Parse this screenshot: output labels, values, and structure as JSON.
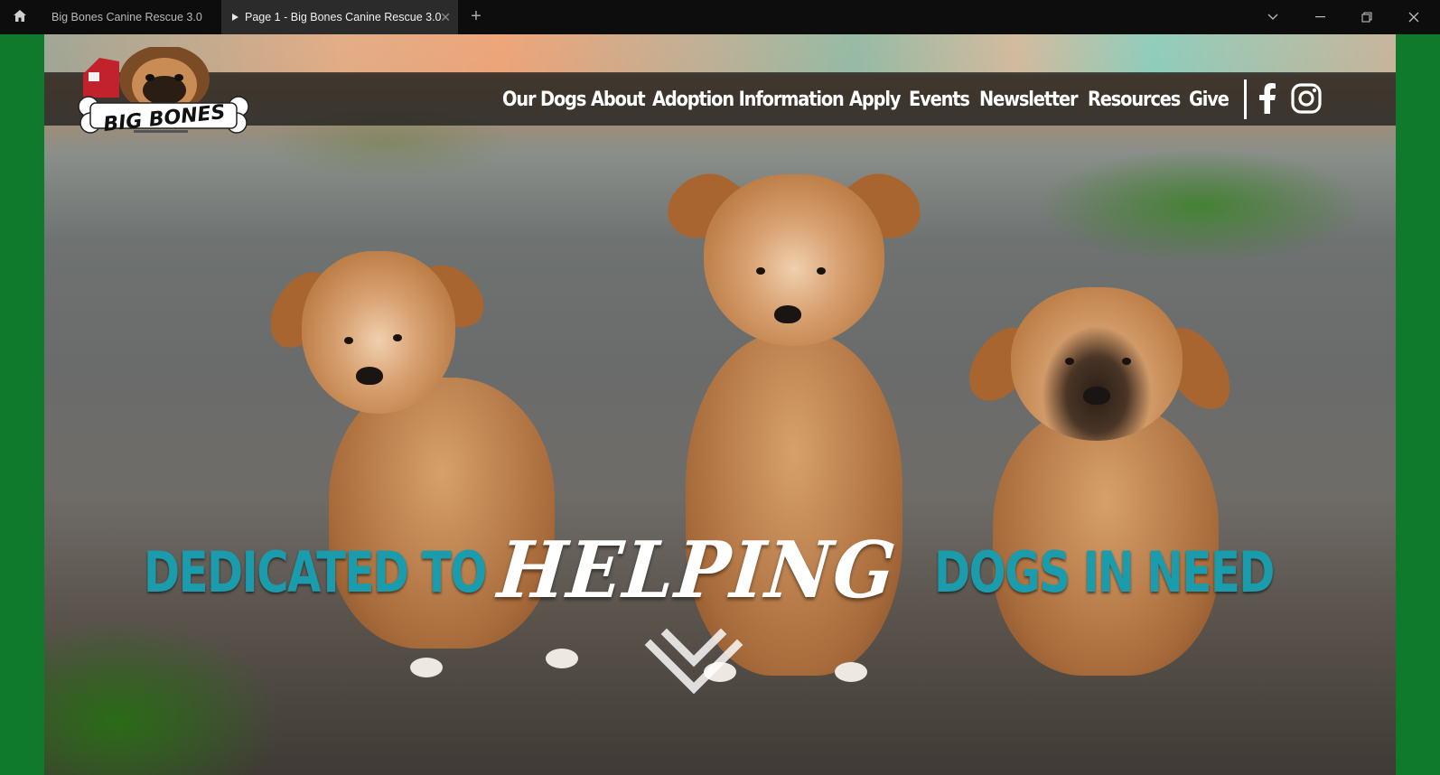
{
  "browser": {
    "tabs": [
      {
        "label": "Big Bones Canine Rescue 3.0",
        "active": false
      },
      {
        "label": "Page 1 - Big Bones Canine Rescue 3.0",
        "active": true
      }
    ],
    "icons": [
      "home-icon",
      "play-icon",
      "close-icon",
      "plus-icon",
      "chevron-down-icon",
      "minimize-icon",
      "restore-icon",
      "close-window-icon"
    ]
  },
  "site": {
    "logo_text": "BIG BONES",
    "nav": [
      "Our Dogs",
      "About",
      "Adoption Information",
      "Apply",
      "Events",
      "Newsletter",
      "Resources",
      "Give"
    ],
    "social": [
      "facebook-icon",
      "instagram-icon"
    ]
  },
  "hero": {
    "part1": "DEDICATED TO",
    "part2": "HELPING",
    "part3": "DOGS IN NEED"
  },
  "colors": {
    "frame_green": "#0f7a2c",
    "hero_teal": "#1a9cad",
    "nav_bar": "rgba(30,30,30,.78)"
  }
}
